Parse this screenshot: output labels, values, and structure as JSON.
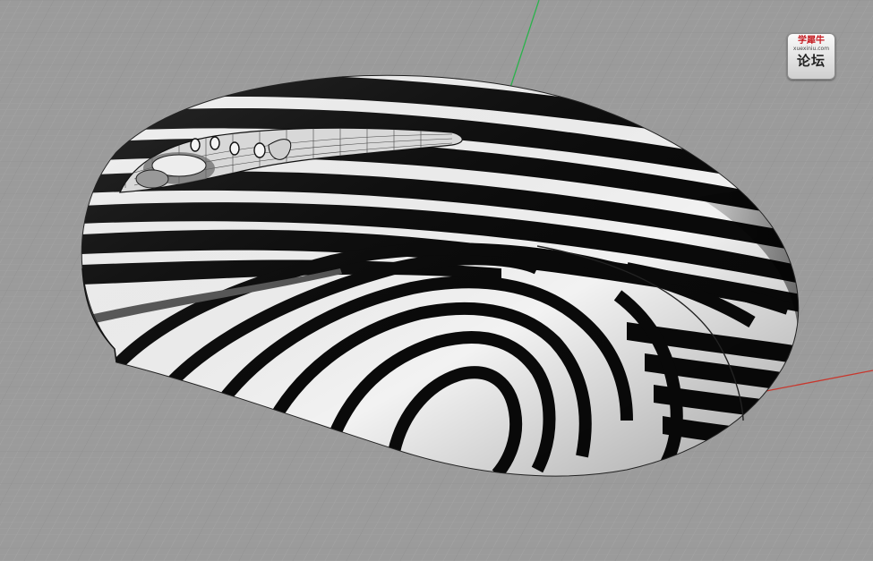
{
  "viewport": {
    "background": "#9a9a9a",
    "grid_minor_color": "#a7a7a7",
    "grid_major_color": "#8b8b8b",
    "x_axis_color": "#c0392b",
    "y_axis_color": "#27ae60",
    "render_mode": "zebra-stripe-analysis",
    "model": "computer-mouse-surface"
  },
  "watermark": {
    "brand": "学犀牛",
    "url": "xuexiniu.com",
    "label": "论坛"
  }
}
